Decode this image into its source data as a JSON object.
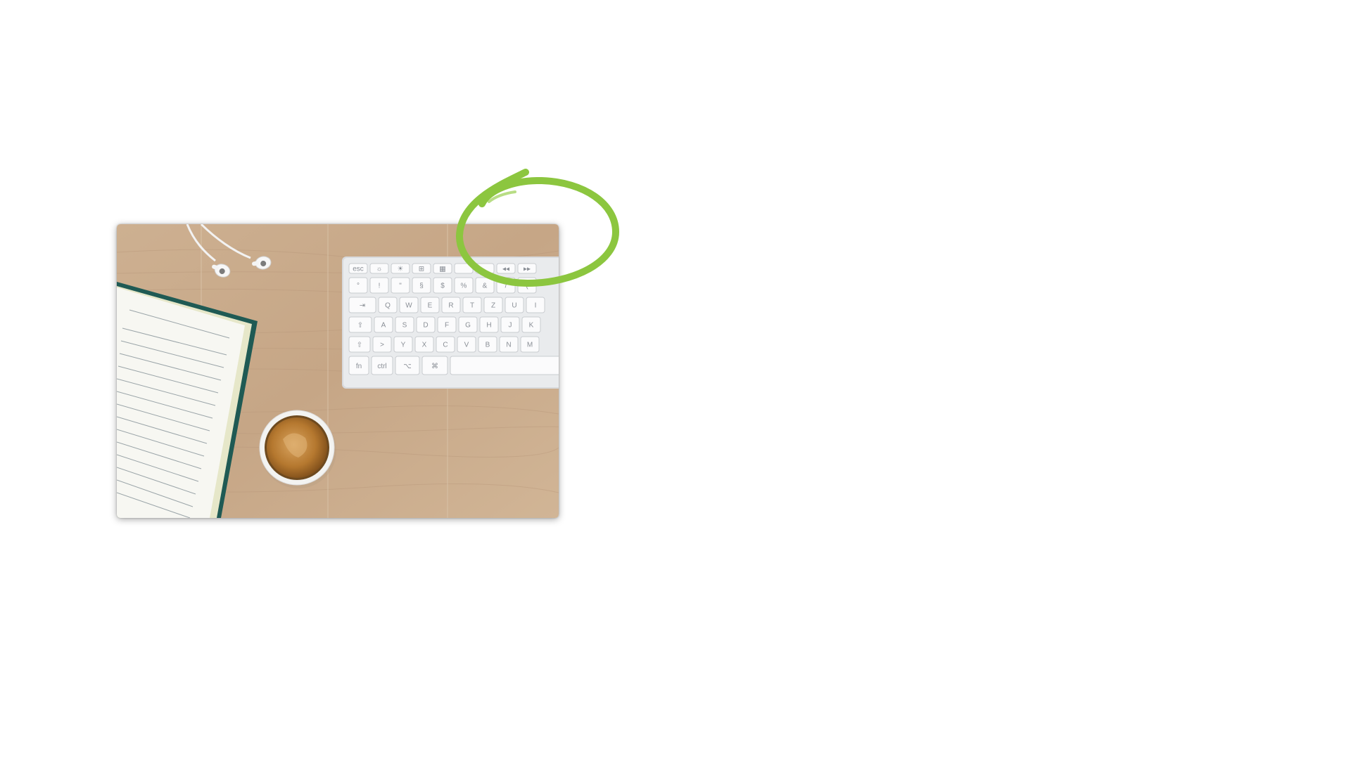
{
  "image": {
    "subject": "desk-flatlay-photo",
    "objects": [
      "earphones",
      "notebook",
      "keyboard",
      "coffee-cup"
    ]
  },
  "keyboard": {
    "row_fn": [
      "esc",
      "☼",
      "☀",
      "⊞",
      "▦",
      "",
      "",
      "◂◂",
      "▸▸"
    ],
    "row_num": [
      "°",
      "!",
      "\"",
      "§",
      "$",
      "%",
      "&",
      "/",
      "("
    ],
    "row_q": [
      "⇥",
      "Q",
      "W",
      "E",
      "R",
      "T",
      "Z",
      "U",
      "I"
    ],
    "row_a": [
      "⇪",
      "A",
      "S",
      "D",
      "F",
      "G",
      "H",
      "J",
      "K"
    ],
    "row_y": [
      "⇧",
      ">",
      "Y",
      "X",
      "C",
      "V",
      "B",
      "N",
      "M"
    ],
    "row_bottom": [
      "fn",
      "ctrl",
      "⌥",
      "⌘"
    ]
  },
  "colors": {
    "wood": "#c9ab8d",
    "highlight": "#8cc63f",
    "notebook_cover": "#1f5a54",
    "coffee": "#b3762e"
  }
}
